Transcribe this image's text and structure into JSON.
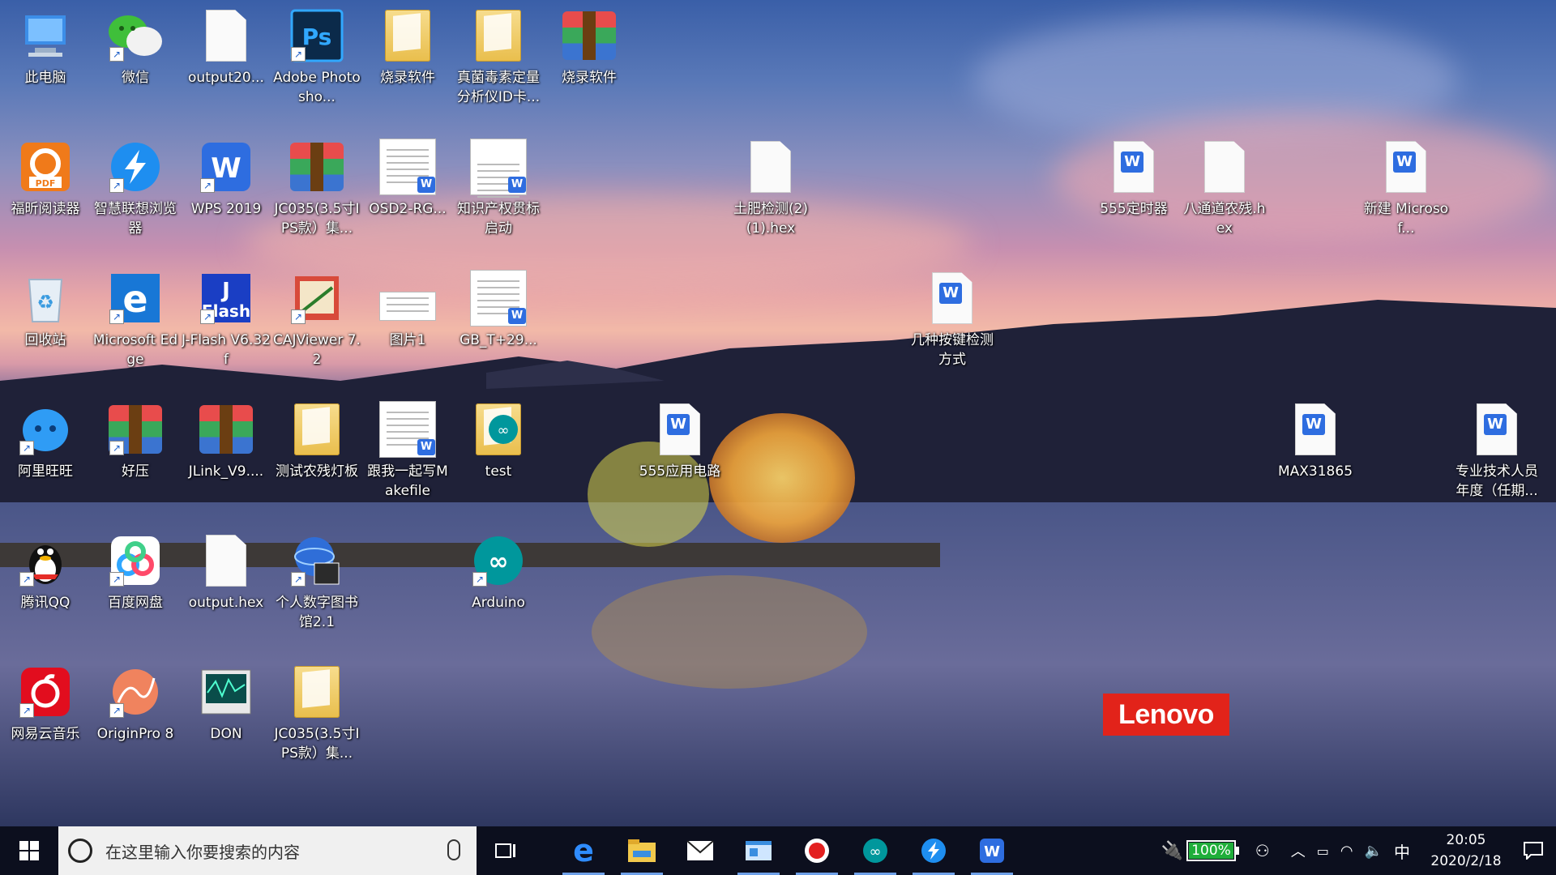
{
  "desktop": {
    "icons": [
      {
        "label": "此电脑"
      },
      {
        "label": "微信"
      },
      {
        "label": "output20..."
      },
      {
        "label": "Adobe Photosho..."
      },
      {
        "label": "烧录软件"
      },
      {
        "label": "真菌毒素定量分析仪ID卡..."
      },
      {
        "label": "烧录软件"
      },
      {
        "label": "福昕阅读器"
      },
      {
        "label": "智慧联想浏览器"
      },
      {
        "label": "WPS 2019"
      },
      {
        "label": "JC035(3.5寸IPS款）集..."
      },
      {
        "label": "OSD2-RG..."
      },
      {
        "label": "知识产权贯标启动"
      },
      {
        "label": "土肥检测(2)(1).hex"
      },
      {
        "label": "555定时器"
      },
      {
        "label": "八通道农残.hex"
      },
      {
        "label": "新建 Microsof..."
      },
      {
        "label": "回收站"
      },
      {
        "label": "Microsoft Edge"
      },
      {
        "label": "J-Flash V6.32f"
      },
      {
        "label": "CAJViewer 7.2"
      },
      {
        "label": "图片1"
      },
      {
        "label": "GB_T+29..."
      },
      {
        "label": "几种按键检测方式"
      },
      {
        "label": "阿里旺旺"
      },
      {
        "label": "好压"
      },
      {
        "label": "JLink_V9...."
      },
      {
        "label": "测试农残灯板"
      },
      {
        "label": "跟我一起写Makefile"
      },
      {
        "label": "test"
      },
      {
        "label": "555应用电路"
      },
      {
        "label": "MAX31865"
      },
      {
        "label": "专业技术人员年度（任期..."
      },
      {
        "label": "腾讯QQ"
      },
      {
        "label": "百度网盘"
      },
      {
        "label": "output.hex"
      },
      {
        "label": "个人数字图书馆2.1"
      },
      {
        "label": "Arduino"
      },
      {
        "label": "网易云音乐"
      },
      {
        "label": "OriginPro 8"
      },
      {
        "label": "DON"
      },
      {
        "label": "JC035(3.5寸IPS款）集..."
      }
    ],
    "wallpaper_brand": "Lenovo"
  },
  "taskbar": {
    "search_placeholder": "在这里输入你要搜索的内容",
    "battery_percent": "100%",
    "ime": "中",
    "time": "20:05",
    "date": "2020/2/18"
  },
  "colors": {
    "taskbar_bg": "#0c0f1e",
    "accent": "#6ea0e8",
    "lenovo_red": "#e2231a"
  }
}
